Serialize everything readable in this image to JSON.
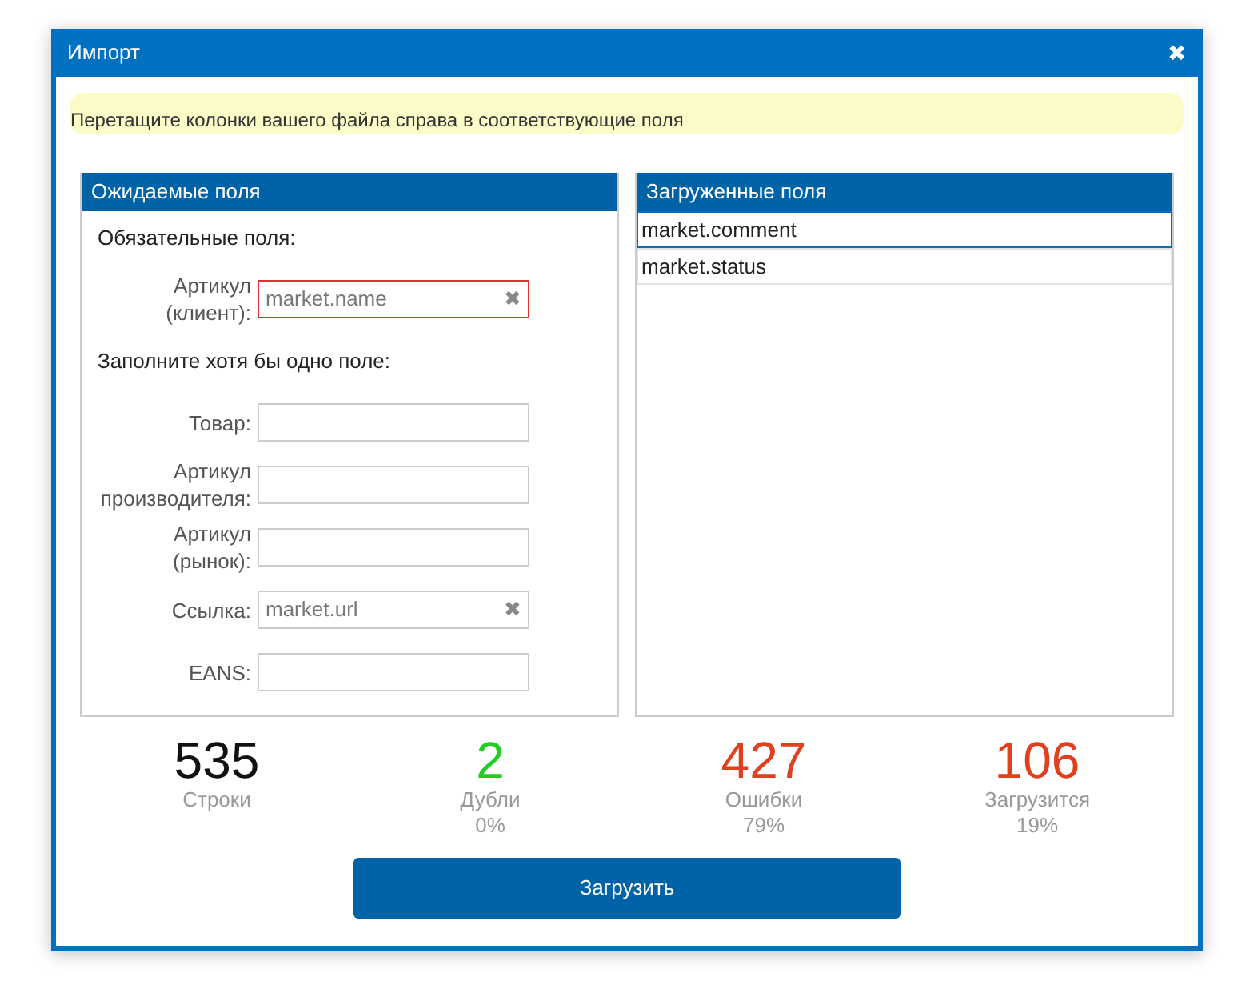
{
  "window": {
    "title": "Импорт",
    "close": "✖"
  },
  "hint": "Перетащите колонки вашего файла справа в соответствующие поля",
  "expected": {
    "title": "Ожидаемые поля",
    "sections": [
      {
        "title": "Обязательные поля:",
        "fields": [
          {
            "label": "Артикул\n(клиент):",
            "value": "market.name",
            "clear": "✖",
            "invalid": true
          }
        ]
      },
      {
        "title": "Заполните хотя бы одно поле:",
        "fields": [
          {
            "label": "Товар:",
            "invalid": false
          },
          {
            "label": "Артикул\nпроизводителя:",
            "invalid": false
          },
          {
            "label": "Артикул\n(рынок):",
            "invalid": false
          },
          {
            "label": "Ссылка:",
            "value": "market.url",
            "clear": "✖",
            "invalid": false
          },
          {
            "label": "EANS:",
            "invalid": false
          }
        ]
      }
    ]
  },
  "loaded": {
    "title": "Загруженные поля",
    "items": [
      {
        "label": "market.comment",
        "selected": true
      },
      {
        "label": "market.status",
        "selected": false
      }
    ]
  },
  "stats": [
    {
      "value": "535",
      "label": "Строки",
      "color": "#111111"
    },
    {
      "value": "2",
      "label": "Дубли",
      "percent": "0%",
      "color": "#22cc22"
    },
    {
      "value": "427",
      "label": "Ошибки",
      "percent": "79%",
      "color": "#e0401e"
    },
    {
      "value": "106",
      "label": "Загрузится",
      "percent": "19%",
      "color": "#e0401e"
    }
  ],
  "button": "Загрузить"
}
